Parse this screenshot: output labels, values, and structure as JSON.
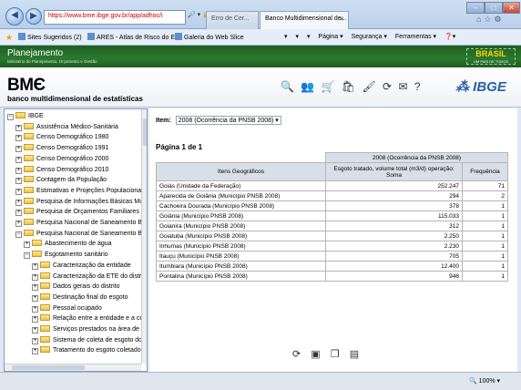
{
  "browser": {
    "address": "https://www.bme.ibge.gov.br/app/adhoc/i",
    "address_icons": "🔎 ▾ 🔒 ✕",
    "tabs": [
      {
        "label": "Erro de Cer..."
      },
      {
        "label": "Banco Multidimensional de..."
      }
    ],
    "favorites": [
      "Sites Sugeridos (2)",
      "ARES - Atlas de Risco do E...",
      "Galeria do Web Slice"
    ],
    "commands": [
      "▾",
      "▾",
      "▾",
      "Página ▾",
      "Segurança ▾",
      "Ferramentas ▾",
      "❓▾"
    ],
    "zoom": "100%"
  },
  "banner": {
    "title": "Planejamento",
    "subtitle": "Ministério do Planejamento, Orçamento e Gestão",
    "brasil": "BRASIL",
    "brasil_sub": "UM PAÍS DE TODOS"
  },
  "header": {
    "logo": "BMЄ",
    "subtitle": "banco multidimensional de estatísticas",
    "brand": "IBGE"
  },
  "tree": [
    {
      "label": "IBGE",
      "level": 0,
      "exp": "−"
    },
    {
      "label": "Assistência Médico-Sanitária",
      "level": 1,
      "exp": "+"
    },
    {
      "label": "Censo Demográfico 1980",
      "level": 1,
      "exp": "+"
    },
    {
      "label": "Censo Demográfico 1991",
      "level": 1,
      "exp": "+"
    },
    {
      "label": "Censo Demográfico 2000",
      "level": 1,
      "exp": "+"
    },
    {
      "label": "Censo Demográfico 2010",
      "level": 1,
      "exp": "+"
    },
    {
      "label": "Contagem da População",
      "level": 1,
      "exp": "+"
    },
    {
      "label": "Estimativas e Projeções Populacionais",
      "level": 1,
      "exp": "+"
    },
    {
      "label": "Pesquisa de Informações Básicas Mun",
      "level": 1,
      "exp": "+"
    },
    {
      "label": "Pesquisa de Orçamentos Familiares -",
      "level": 1,
      "exp": "+"
    },
    {
      "label": "Pesquisa Nacional de Saneamento Bá",
      "level": 1,
      "exp": "+"
    },
    {
      "label": "Pesquisa Nacional de Saneamento Bá",
      "level": 1,
      "exp": "−"
    },
    {
      "label": "Abastecimento de água",
      "level": 2,
      "exp": "+"
    },
    {
      "label": "Esgotamento sanitário",
      "level": 2,
      "exp": "−"
    },
    {
      "label": "Caracterização da entidade",
      "level": 3,
      "exp": "+"
    },
    {
      "label": "Caracterização da ETE do distrit",
      "level": 3,
      "exp": "+"
    },
    {
      "label": "Dados gerais do distrito",
      "level": 3,
      "exp": "+"
    },
    {
      "label": "Destinação final do esgoto",
      "level": 3,
      "exp": "+"
    },
    {
      "label": "Pessoal ocupado",
      "level": 3,
      "exp": "+"
    },
    {
      "label": "Relação entre a entidade e a cor",
      "level": 3,
      "exp": "+"
    },
    {
      "label": "Serviços prestados na área de a",
      "level": 3,
      "exp": "+"
    },
    {
      "label": "Sistema de coleta de esgoto do",
      "level": 3,
      "exp": "+"
    },
    {
      "label": "Tratamento do esgoto coletado",
      "level": 3,
      "exp": "+"
    }
  ],
  "content": {
    "item_label": "Item:",
    "item_value": "2008 (Ocorrência da PNSB 2008)",
    "page": "Página 1 de 1",
    "table": {
      "caption": "2008 (Ocorrência da PNSB 2008)",
      "col_geo": "Itens Geográficos",
      "col_esgoto": "Esgoto tratado, volume total (m3/d) operação: Soma",
      "col_freq": "Frequência",
      "rows": [
        {
          "name": "Goiás (Unidade da Federação)",
          "value": "252.247",
          "freq": "71"
        },
        {
          "name": "Aparecida de Goiânia (Município PNSB 2008)",
          "value": "294",
          "freq": "2"
        },
        {
          "name": "Cachoeira Dourada (Município PNSB 2008)",
          "value": "378",
          "freq": "1"
        },
        {
          "name": "Goiânia (Município PNSB 2008)",
          "value": "115.033",
          "freq": "1"
        },
        {
          "name": "Goianira (Município PNSB 2008)",
          "value": "312",
          "freq": "1"
        },
        {
          "name": "Goiatuba (Município PNSB 2008)",
          "value": "2.250",
          "freq": "1"
        },
        {
          "name": "Inhumas (Município PNSB 2008)",
          "value": "2.230",
          "freq": "1"
        },
        {
          "name": "Itauçu (Município PNSB 2008)",
          "value": "705",
          "freq": "1"
        },
        {
          "name": "Itumbiara (Município PNSB 2008)",
          "value": "12.400",
          "freq": "1"
        },
        {
          "name": "Pontalina (Município PNSB 2008)",
          "value": "946",
          "freq": "1"
        }
      ]
    }
  }
}
